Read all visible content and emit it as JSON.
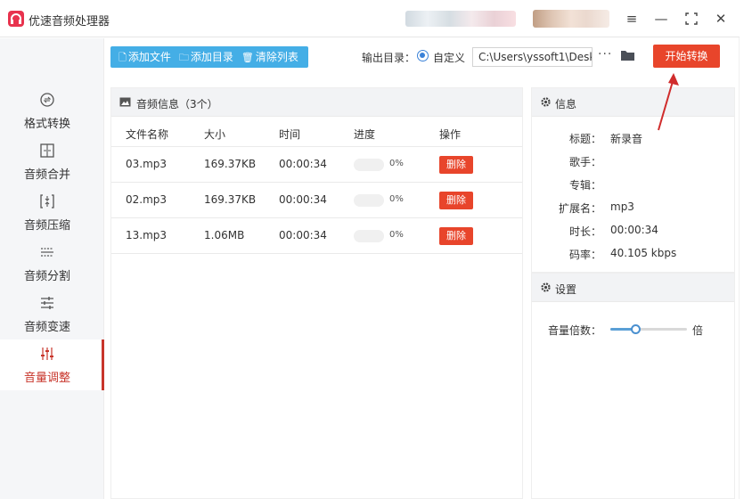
{
  "app": {
    "title": "优速音频处理器"
  },
  "window_controls": {
    "menu": "≡",
    "minimize": "—",
    "maximize": "⛶",
    "close": "✕"
  },
  "sidebar": {
    "items": [
      {
        "label": "格式转换",
        "icon": "format-convert-icon",
        "active": false
      },
      {
        "label": "音频合并",
        "icon": "merge-icon",
        "active": false
      },
      {
        "label": "音频压缩",
        "icon": "compress-icon",
        "active": false
      },
      {
        "label": "音频分割",
        "icon": "split-icon",
        "active": false
      },
      {
        "label": "音频变速",
        "icon": "speed-icon",
        "active": false
      },
      {
        "label": "音量调整",
        "icon": "volume-adjust-icon",
        "active": true
      }
    ]
  },
  "toolbar": {
    "add_file": "添加文件",
    "add_folder": "添加目录",
    "clear_list": "清除列表",
    "output_label": "输出目录：",
    "radio_label": "自定义",
    "output_path": "C:\\Users\\yssoft1\\Deskt",
    "more": "···",
    "start_button": "开始转换"
  },
  "audio_panel": {
    "title": "音频信息（3个）",
    "columns": [
      "文件名称",
      "大小",
      "时间",
      "进度",
      "操作"
    ],
    "rows": [
      {
        "name": "03.mp3",
        "size": "169.37KB",
        "time": "00:00:34",
        "progress": "0%",
        "action": "删除"
      },
      {
        "name": "02.mp3",
        "size": "169.37KB",
        "time": "00:00:34",
        "progress": "0%",
        "action": "删除"
      },
      {
        "name": "13.mp3",
        "size": "1.06MB",
        "time": "00:00:34",
        "progress": "0%",
        "action": "删除"
      }
    ]
  },
  "info_panel": {
    "title": "信息",
    "fields": [
      {
        "key": "标题：",
        "value": "新录音"
      },
      {
        "key": "歌手：",
        "value": ""
      },
      {
        "key": "专辑：",
        "value": ""
      },
      {
        "key": "扩展名：",
        "value": "mp3"
      },
      {
        "key": "时长：",
        "value": "00:00:34"
      },
      {
        "key": "码率：",
        "value": "40.105 kbps"
      }
    ]
  },
  "settings_panel": {
    "title": "设置",
    "volume_label": "音量倍数：",
    "volume_unit": "倍",
    "volume_level": 0.33
  },
  "colors": {
    "accent_red": "#e8452b",
    "toolbar_blue": "#44aee6",
    "active_nav": "#c8352b",
    "slider_blue": "#4a90d0"
  }
}
